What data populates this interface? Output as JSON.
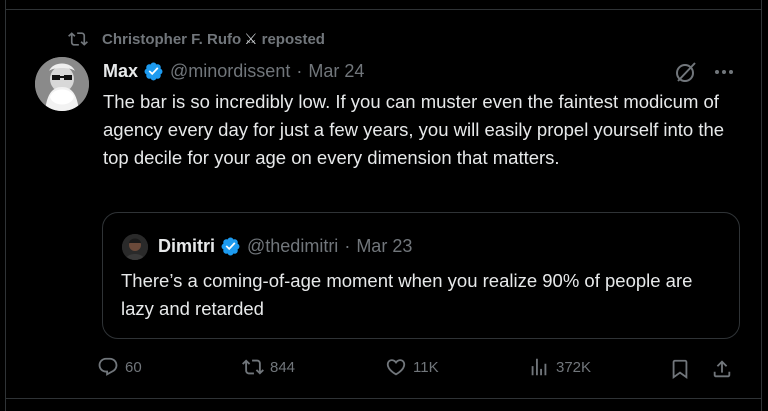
{
  "repost": {
    "user": "Christopher F. Rufo",
    "badge_icon": "crossed-swords-icon",
    "suffix": "reposted"
  },
  "tweet": {
    "name": "Max",
    "handle": "@minordissent",
    "separator": "·",
    "date": "Mar 24",
    "text": "The bar is so incredibly low. If you can muster even the faintest modicum of agency every day for just a few years, you will easily propel yourself into the top decile for your age on every dimension that matters."
  },
  "quote": {
    "name": "Dimitri",
    "handle": "@thedimitri",
    "separator": "·",
    "date": "Mar 23",
    "text": "There’s a coming-of-age moment when you realize 90% of people are lazy and retarded"
  },
  "actions": {
    "replies": "60",
    "reposts": "844",
    "likes": "11K",
    "views": "372K"
  },
  "colors": {
    "background": "#000000",
    "text": "#e7e9ea",
    "muted": "#71767b",
    "verified": "#1d9bf0",
    "border": "#2f3336"
  }
}
